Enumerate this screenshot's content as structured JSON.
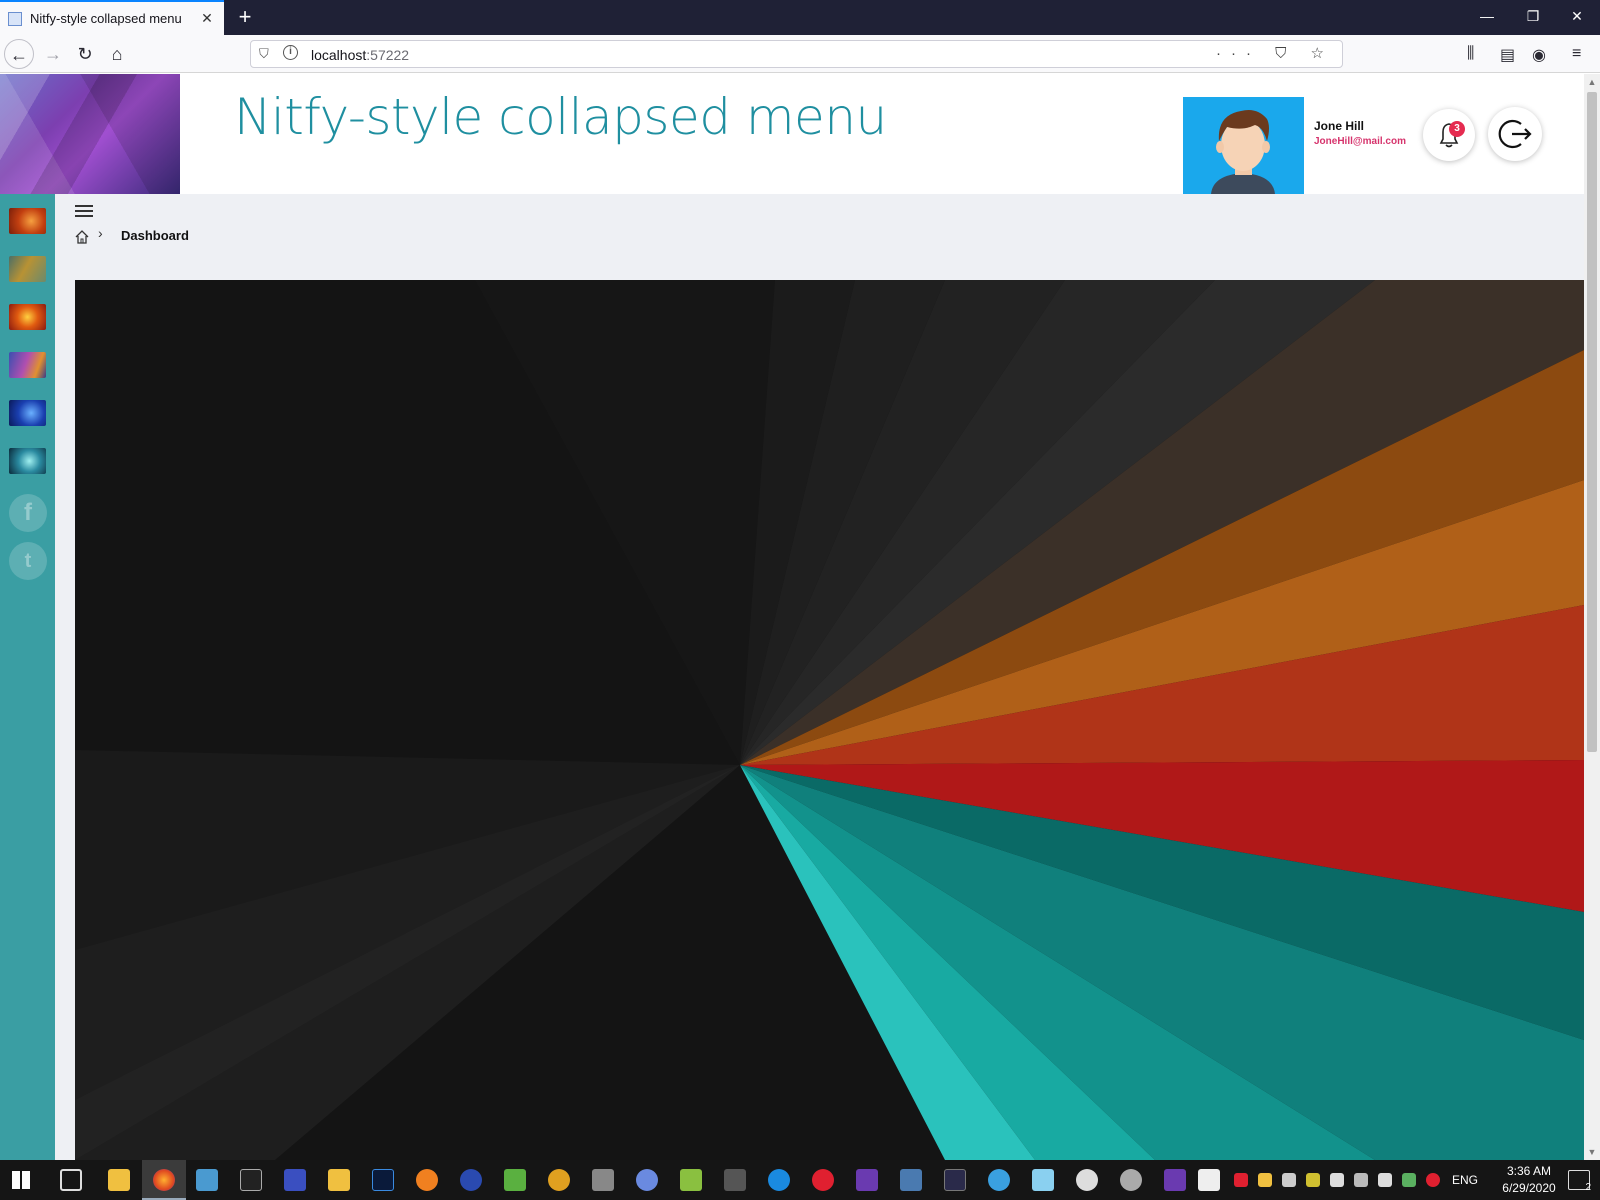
{
  "browser": {
    "tab_title": "Nitfy-style collapsed menu",
    "tab_close": "✕",
    "new_tab": "+",
    "url_host": "localhost",
    "url_port": ":57222",
    "url_actions": "··· ⛉ ☆",
    "window_controls": {
      "minimize": "—",
      "restore": "❐",
      "close": "✕"
    }
  },
  "header": {
    "title": "Nitfy-style collapsed menu",
    "user": {
      "name": "Jone Hill",
      "email": "JoneHill@mail.com"
    },
    "notifications": {
      "count": "3"
    }
  },
  "breadcrumb": {
    "separator": "›",
    "current": "Dashboard"
  },
  "sidebar": {
    "social": [
      {
        "label": "f"
      },
      {
        "label": "t"
      }
    ]
  },
  "taskbar": {
    "language": "ENG",
    "time": "3:36 AM",
    "date": "6/29/2020",
    "action_center_count": "2"
  }
}
